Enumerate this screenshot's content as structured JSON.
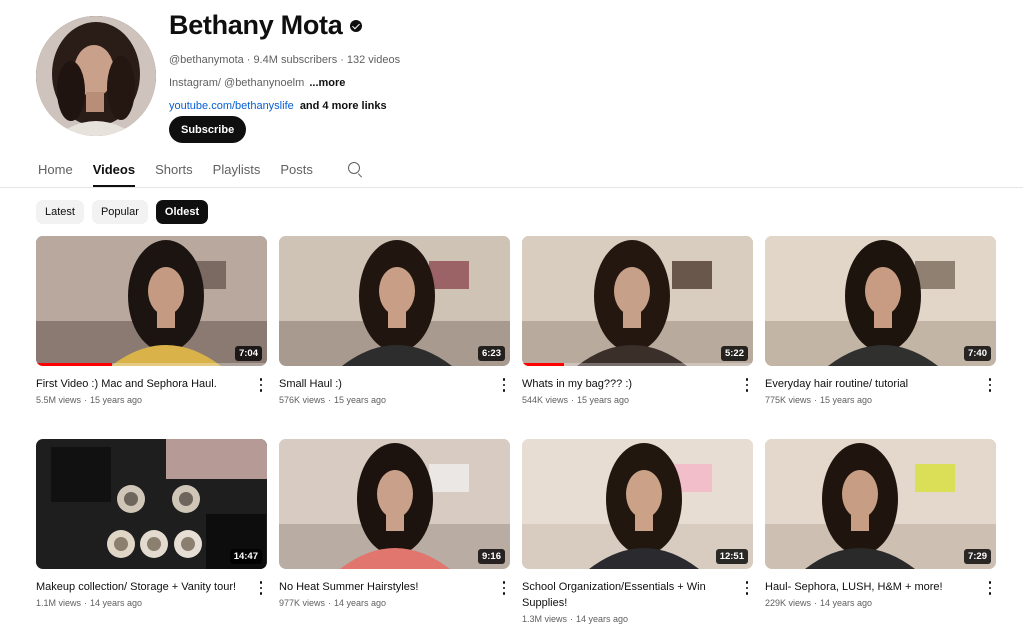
{
  "channel": {
    "name": "Bethany Mota",
    "handle": "@bethanymota",
    "subscribers": "9.4M subscribers",
    "video_count": "132 videos",
    "description": "Instagram/ @bethanynoelm",
    "description_more": "...more",
    "link": "youtube.com/bethanyslife",
    "more_links": "and 4 more links",
    "subscribe_label": "Subscribe",
    "separator": "·"
  },
  "tabs": [
    {
      "label": "Home",
      "active": false
    },
    {
      "label": "Videos",
      "active": true
    },
    {
      "label": "Shorts",
      "active": false
    },
    {
      "label": "Playlists",
      "active": false
    },
    {
      "label": "Posts",
      "active": false
    }
  ],
  "chips": [
    {
      "label": "Latest",
      "active": false
    },
    {
      "label": "Popular",
      "active": false
    },
    {
      "label": "Oldest",
      "active": true
    }
  ],
  "videos": [
    {
      "title": "First Video :) Mac and Sephora Haul.",
      "views": "5.5M views",
      "age": "15 years ago",
      "duration": "7:04",
      "watched": 0.33
    },
    {
      "title": "Small Haul :)",
      "views": "576K views",
      "age": "15 years ago",
      "duration": "6:23",
      "watched": 0
    },
    {
      "title": "Whats in my bag??? :)",
      "views": "544K views",
      "age": "15 years ago",
      "duration": "5:22",
      "watched": 0.18
    },
    {
      "title": "Everyday hair routine/ tutorial",
      "views": "775K views",
      "age": "15 years ago",
      "duration": "7:40",
      "watched": 0
    },
    {
      "title": "Makeup collection/ Storage + Vanity tour!",
      "views": "1.1M views",
      "age": "14 years ago",
      "duration": "14:47",
      "watched": 0
    },
    {
      "title": "No Heat Summer Hairstyles!",
      "views": "977K views",
      "age": "14 years ago",
      "duration": "9:16",
      "watched": 0
    },
    {
      "title": "School Organization/Essentials + Win Supplies!",
      "views": "1.3M views",
      "age": "14 years ago",
      "duration": "12:51",
      "watched": 0
    },
    {
      "title": "Haul- Sephora, LUSH, H&M + more!",
      "views": "229K views",
      "age": "14 years ago",
      "duration": "7:29",
      "watched": 0
    }
  ]
}
